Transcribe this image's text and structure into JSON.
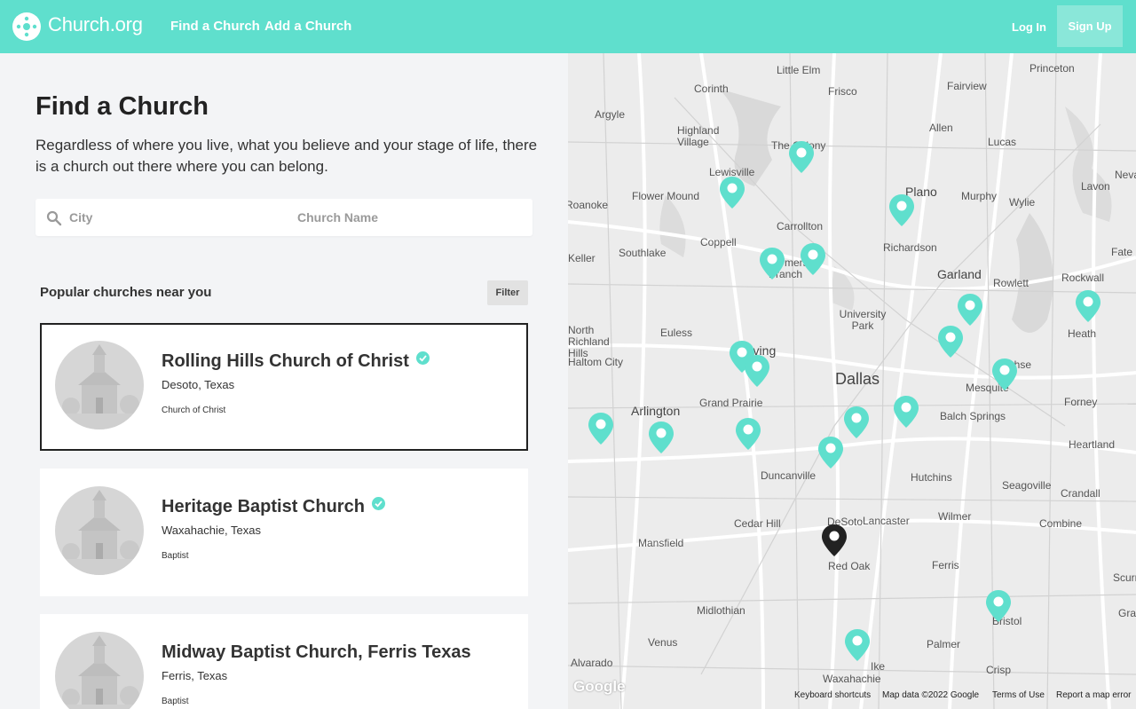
{
  "header": {
    "brand": "Church.org",
    "nav": [
      "Find a Church",
      "Add a Church"
    ],
    "login": "Log In",
    "signup": "Sign Up",
    "accent_color": "#5fdfcd"
  },
  "main": {
    "title": "Find a Church",
    "subtitle": "Regardless of where you live, what you believe and your stage of life, there is a church out there where you can belong.",
    "search": {
      "city_placeholder": "City",
      "name_placeholder": "Church Name",
      "icon": "search-icon"
    },
    "section_title": "Popular churches near you",
    "filter_label": "Filter",
    "churches": [
      {
        "name": "Rolling Hills Church of Christ",
        "location": "Desoto, Texas",
        "denomination": "Church of Christ",
        "verified": true,
        "selected": true
      },
      {
        "name": "Heritage Baptist Church",
        "location": "Waxahachie, Texas",
        "denomination": "Baptist",
        "verified": true,
        "selected": false
      },
      {
        "name": "Midway Baptist Church, Ferris Texas",
        "location": "Ferris, Texas",
        "denomination": "Baptist",
        "verified": false,
        "selected": false
      }
    ]
  },
  "map": {
    "places": [
      "Little Elm",
      "Princeton",
      "Corinth",
      "Frisco",
      "Fairview",
      "Argyle",
      "Highland Village",
      "Allen",
      "Lucas",
      "The Colony",
      "Nevada",
      "Lewisville",
      "Lavon",
      "Flower Mound",
      "Plano",
      "Murphy",
      "Wylie",
      "Roanoke",
      "Carrollton",
      "Coppell",
      "Richardson",
      "Keller",
      "Southlake",
      "Farmers Branch",
      "Garland",
      "Rowlett",
      "Fate",
      "Rockwall",
      "University Park",
      "North Richland Hills",
      "Euless",
      "Irving",
      "Heath",
      "Haltom City",
      "Sachse",
      "Dallas",
      "Mesquite",
      "Grand Prairie",
      "Arlington",
      "Forney",
      "Balch Springs",
      "Heartland",
      "Hutchins",
      "Duncanville",
      "Seagoville",
      "Crandall",
      "Cedar Hill",
      "DeSoto",
      "Lancaster",
      "Wilmer",
      "Combine",
      "Mansfield",
      "Red Oak",
      "Ferris",
      "Scurry",
      "Midlothian",
      "Bristol",
      "Grays Prairie",
      "Venus",
      "Palmer",
      "Alvarado",
      "Ike",
      "Crisp",
      "Waxahachie"
    ],
    "pin_color": "#5fdfcd",
    "selected_pin_color": "#222222",
    "google_logo": "Google",
    "footer": [
      "Keyboard shortcuts",
      "Map data ©2022 Google",
      "Terms of Use",
      "Report a map error"
    ]
  }
}
